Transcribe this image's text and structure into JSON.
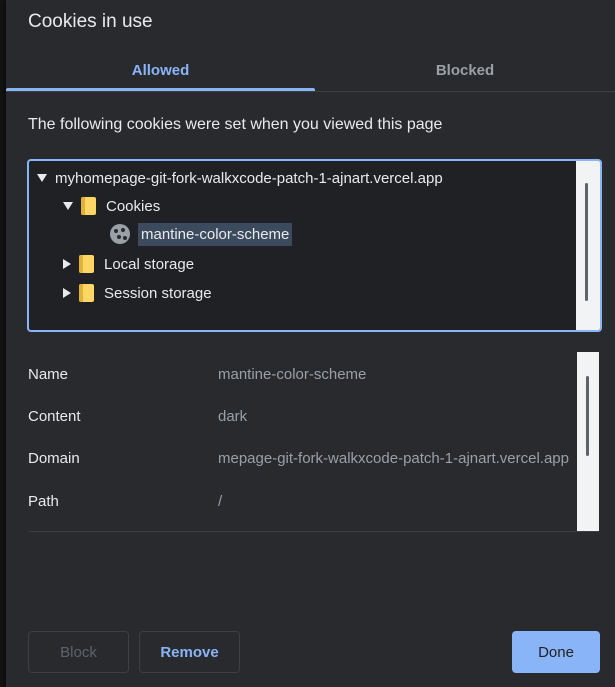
{
  "dialog": {
    "title": "Cookies in use",
    "description": "The following cookies were set when you viewed this page"
  },
  "tabs": [
    {
      "label": "Allowed",
      "selected": true
    },
    {
      "label": "Blocked",
      "selected": false
    }
  ],
  "tree": {
    "site": "myhomepage-git-fork-walkxcode-patch-1-ajnart.vercel.app",
    "cookies_label": "Cookies",
    "cookie_item": "mantine-color-scheme",
    "local_storage_label": "Local storage",
    "session_storage_label": "Session storage"
  },
  "details": [
    {
      "key": "Name",
      "value": "mantine-color-scheme"
    },
    {
      "key": "Content",
      "value": "dark"
    },
    {
      "key": "Domain",
      "value": "mepage-git-fork-walkxcode-patch-1-ajnart.vercel.app"
    },
    {
      "key": "Path",
      "value": "/"
    }
  ],
  "buttons": {
    "block": "Block",
    "remove": "Remove",
    "done": "Done"
  },
  "colors": {
    "accent": "#8ab4f8",
    "background": "#292a2d",
    "folder": "#fdd663"
  }
}
